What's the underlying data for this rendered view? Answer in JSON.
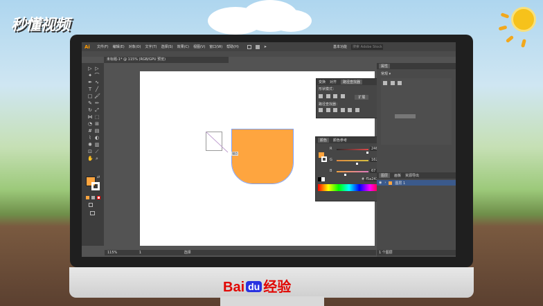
{
  "watermark": {
    "text": "秒懂视频"
  },
  "brand": {
    "bai": "Bai",
    "du": "du",
    "jingyan": "经验"
  },
  "app": {
    "logo": "Ai",
    "menu": [
      "文件(F)",
      "编辑(E)",
      "对象(O)",
      "文字(T)",
      "选择(S)",
      "效果(C)",
      "视图(V)",
      "窗口(W)",
      "帮助(H)"
    ],
    "workspace": "基本功能",
    "search_placeholder": "搜索 Adobe Stock"
  },
  "document_tab": {
    "label": "未标题-1* @ 115% (RGB/GPU 预览)"
  },
  "pathfinder_panel": {
    "tabs": [
      "变换",
      "对齐",
      "路径查找器"
    ],
    "shape_modes_label": "形状模式：",
    "expand_button": "扩展",
    "pathfinders_label": "路径查找器："
  },
  "color_panel": {
    "tabs": [
      "颜色",
      "颜色参考"
    ],
    "channels": [
      {
        "label": "R",
        "value": "246",
        "fraction": 0.96,
        "color": "#e04a4a"
      },
      {
        "label": "G",
        "value": "162",
        "fraction": 0.64,
        "color": "#d6a040"
      },
      {
        "label": "B",
        "value": "67",
        "fraction": 0.26,
        "color": "#e07ac0"
      }
    ],
    "hex_prefix": "#",
    "hex_value": "f5a243",
    "fill_color": "#f5a243"
  },
  "properties_panel": {
    "tab": "属性",
    "mode_label": "常规"
  },
  "layers_panel": {
    "tabs": [
      "图层",
      "画板",
      "资源导出"
    ],
    "layers": [
      {
        "name": "图层 1"
      }
    ],
    "layer_count": "1 个图层"
  },
  "canvas": {
    "smart_guide_label": "锚点",
    "shape_color": "#fea53f"
  },
  "status_bar": {
    "zoom": "115%",
    "page": "1",
    "mode_label": "选择"
  },
  "colors": {
    "accent": "#ff9a00",
    "ui_dark": "#535353"
  }
}
